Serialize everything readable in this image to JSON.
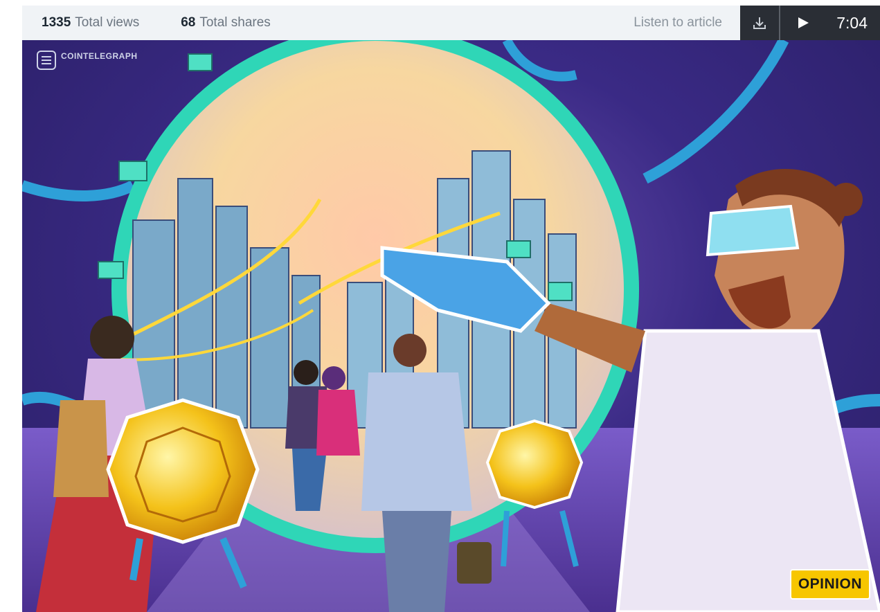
{
  "stats": {
    "views_count": "1335",
    "views_label": "Total views",
    "shares_count": "68",
    "shares_label": "Total shares"
  },
  "audio": {
    "listen_label": "Listen to article",
    "duration": "7:04",
    "download_icon": "download-icon",
    "play_icon": "play-icon"
  },
  "hero": {
    "brand": "COINTELEGRAPH",
    "badge": "OPINION"
  },
  "colors": {
    "topbar_bg": "#f0f3f6",
    "player_bg": "#2a2e35",
    "badge_bg": "#f7c600"
  }
}
